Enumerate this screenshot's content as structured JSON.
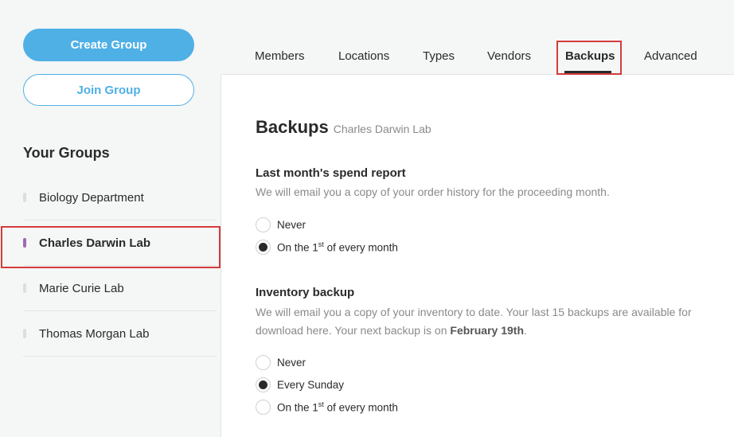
{
  "sidebar": {
    "create_button": "Create Group",
    "join_button": "Join Group",
    "groups_heading": "Your Groups",
    "groups": [
      {
        "label": "Biology Department",
        "active": false
      },
      {
        "label": "Charles Darwin Lab",
        "active": true
      },
      {
        "label": "Marie Curie Lab",
        "active": false
      },
      {
        "label": "Thomas Morgan Lab",
        "active": false
      }
    ]
  },
  "tabs": [
    {
      "label": "Members"
    },
    {
      "label": "Locations"
    },
    {
      "label": "Types"
    },
    {
      "label": "Vendors"
    },
    {
      "label": "Backups",
      "active": true
    },
    {
      "label": "Advanced"
    }
  ],
  "page": {
    "title": "Backups",
    "subtitle": "Charles Darwin Lab"
  },
  "spend_report": {
    "title": "Last month's spend report",
    "description": "We will email you a copy of your order history for the proceeding month.",
    "options": [
      {
        "label": "Never",
        "checked": false
      },
      {
        "label_prefix": "On the 1",
        "label_sup": "st",
        "label_suffix": " of every month",
        "checked": true
      }
    ]
  },
  "inventory_backup": {
    "title": "Inventory backup",
    "description_prefix": "We will email you a copy of your inventory to date. Your last 15 backups are available for download here. Your next backup is on ",
    "next_backup_date": "February 19th",
    "description_suffix": ".",
    "options": [
      {
        "label": "Never",
        "checked": false
      },
      {
        "label": "Every Sunday",
        "checked": true
      },
      {
        "label_prefix": "On the 1",
        "label_sup": "st",
        "label_suffix": " of every month",
        "checked": false
      }
    ]
  },
  "colors": {
    "accent": "#4fb0e6",
    "active_marker": "#9b6bb7",
    "highlight": "#d43b3b"
  }
}
